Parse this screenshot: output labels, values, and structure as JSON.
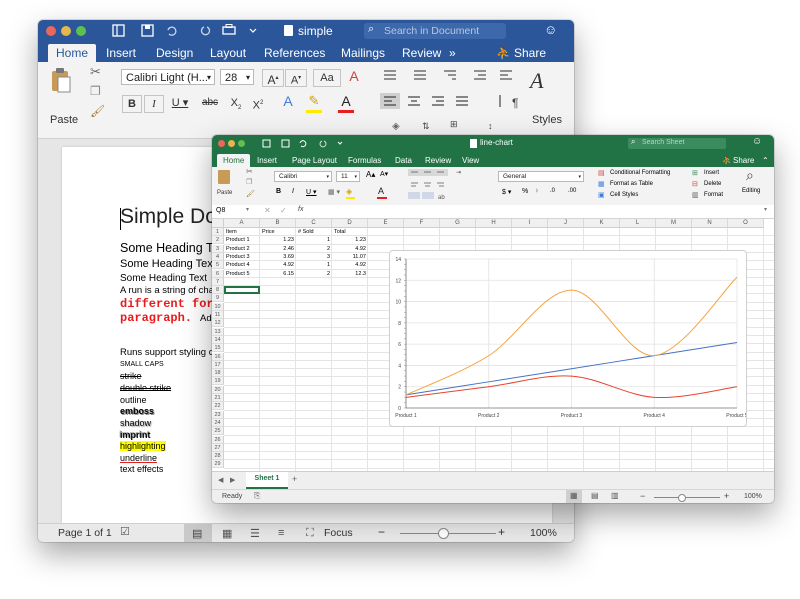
{
  "word": {
    "title": "simple",
    "search_placeholder": "Search in Document",
    "tabs": [
      "Home",
      "Insert",
      "Design",
      "Layout",
      "References",
      "Mailings",
      "Review"
    ],
    "more_tabs": "»",
    "share_label": "Share",
    "paste_label": "Paste",
    "font_name": "Calibri Light (H...",
    "font_size": "28",
    "styles_label": "Styles",
    "doc_lines": {
      "title": "Simple Docu",
      "heading1": "Some Heading Te",
      "heading2": "Some Heading Text",
      "heading3": "Some Heading Text",
      "run": "A run is a string of charac",
      "red1": "different for",
      "red2": "paragraph.",
      "red2_tail": "Ad",
      "runs_support": "Runs support styling op",
      "small_caps": "SMALL CAPS",
      "strike": "strike",
      "double_strike": "double strike",
      "outline": "outline",
      "emboss": "emboss",
      "shadow": "shadow",
      "imprint": "imprint",
      "highlighting": "highlighting",
      "underline": "underline",
      "text_effects": "text effects"
    },
    "status": {
      "page": "Page 1 of 1",
      "focus": "Focus",
      "zoom": "100%"
    }
  },
  "excel": {
    "title": "line-chart",
    "search_placeholder": "Search Sheet",
    "tabs": [
      "Home",
      "Insert",
      "Page Layout",
      "Formulas",
      "Data",
      "Review",
      "View"
    ],
    "share_label": "Share",
    "paste_label": "Paste",
    "font_name": "Calibri",
    "font_size": "11",
    "number_format": "General",
    "cond_format": "Conditional Formatting",
    "format_table": "Format as Table",
    "cell_styles": "Cell Styles",
    "insert_label": "Insert",
    "delete_label": "Delete",
    "format_label": "Format",
    "editing_label": "Editing",
    "name_box": "Q8",
    "fx": "fx",
    "columns": [
      "A",
      "B",
      "C",
      "D",
      "E",
      "F",
      "G",
      "H",
      "I",
      "J",
      "K",
      "L",
      "M",
      "N",
      "O"
    ],
    "rows": [
      "1",
      "2",
      "3",
      "4",
      "5",
      "6",
      "7",
      "8",
      "9",
      "10",
      "11",
      "12",
      "13",
      "14",
      "15",
      "16",
      "17",
      "18",
      "19",
      "20",
      "21",
      "22",
      "23",
      "24",
      "25",
      "26",
      "27",
      "28",
      "29"
    ],
    "headers": [
      "Item",
      "Price",
      "# Sold",
      "Total"
    ],
    "data_rows": [
      [
        "Product 1",
        "1.23",
        "1",
        "1.23"
      ],
      [
        "Product 2",
        "2.46",
        "2",
        "4.92"
      ],
      [
        "Product 3",
        "3.69",
        "3",
        "11.07"
      ],
      [
        "Product 4",
        "4.92",
        "1",
        "4.92"
      ],
      [
        "Product 5",
        "6.15",
        "2",
        "12.3"
      ]
    ],
    "sheet_tab": "Sheet 1",
    "status_ready": "Ready",
    "zoom": "100%"
  },
  "chart_data": {
    "type": "line",
    "categories": [
      "Product 1",
      "Product 2",
      "Product 3",
      "Product 4",
      "Product 5"
    ],
    "series": [
      {
        "values": [
          1.23,
          2.46,
          3.69,
          4.92,
          6.15
        ],
        "color": "#4472c4"
      },
      {
        "values": [
          1,
          2,
          3,
          1,
          2
        ],
        "color": "#e8432f"
      },
      {
        "values": [
          1.23,
          4.92,
          11.07,
          4.92,
          12.3
        ],
        "color": "#f5a33c"
      }
    ],
    "ylim": [
      0,
      14
    ],
    "yticks": [
      "0",
      "2",
      "4",
      "6",
      "8",
      "10",
      "12",
      "14"
    ],
    "grid": true,
    "smooth": true
  }
}
